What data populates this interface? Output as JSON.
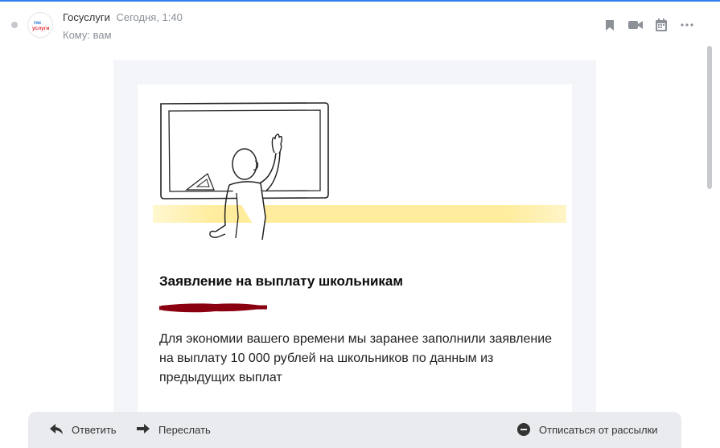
{
  "header": {
    "sender_name": "Госуслуги",
    "date": "Сегодня, 1:40",
    "to": "Кому: вам",
    "avatar_text_top": "гос",
    "avatar_text_bottom": "услуги",
    "actions": [
      "bookmark-icon",
      "video-icon",
      "calendar-icon",
      "more-icon"
    ]
  },
  "email": {
    "title": "Заявление на выплату школьникам",
    "body": "Для экономии вашего времени мы заранее заполнили заявление на выплату 10 000 рублей на школьников по данным из предыдущих выплат"
  },
  "reply_bar": {
    "reply_label": "Ответить",
    "forward_label": "Переслать",
    "unsubscribe_label": "Отписаться от рассылки"
  },
  "colors": {
    "accent": "#2f80ed",
    "highlight": "#ffe98a",
    "redaction": "#8b0010"
  }
}
